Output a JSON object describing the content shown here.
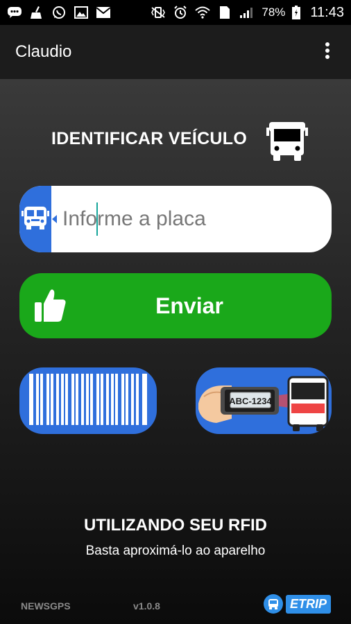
{
  "status_bar": {
    "battery_percent": "78%",
    "time": "11:43",
    "sim_slot": "1",
    "icons_left": [
      "messages-icon",
      "cleaner-icon",
      "whatsapp-icon",
      "gallery-icon",
      "email-icon"
    ],
    "icons_right": [
      "vibrate-icon",
      "alarm-icon",
      "wifi-icon",
      "sim-icon",
      "signal-icon",
      "battery-icon"
    ]
  },
  "app_bar": {
    "title": "Claudio",
    "menu_icon": "more-vert-icon"
  },
  "identify": {
    "title": "IDENTIFICAR VEÍCULO",
    "icon": "bus-icon"
  },
  "plate_input": {
    "placeholder": "Informe a placa",
    "value": "",
    "icon": "school-bus-icon"
  },
  "send_button": {
    "label": "Enviar",
    "icon": "thumbs-up-icon"
  },
  "scan_options": {
    "barcode_icon": "barcode-icon",
    "plate_reader_plate": "ABC-1234",
    "plate_reader_icon": "plate-camera-icon"
  },
  "rfid": {
    "title": "UTILIZANDO SEU RFID",
    "subtitle": "Basta aproximá-lo ao aparelho"
  },
  "footer": {
    "brand": "NEWSGPS",
    "version": "v1.0.8",
    "logo_text": "ETRIP"
  },
  "colors": {
    "accent_blue": "#2f6fdc",
    "send_green": "#1aa81a",
    "app_bar": "#1c1c1c"
  }
}
